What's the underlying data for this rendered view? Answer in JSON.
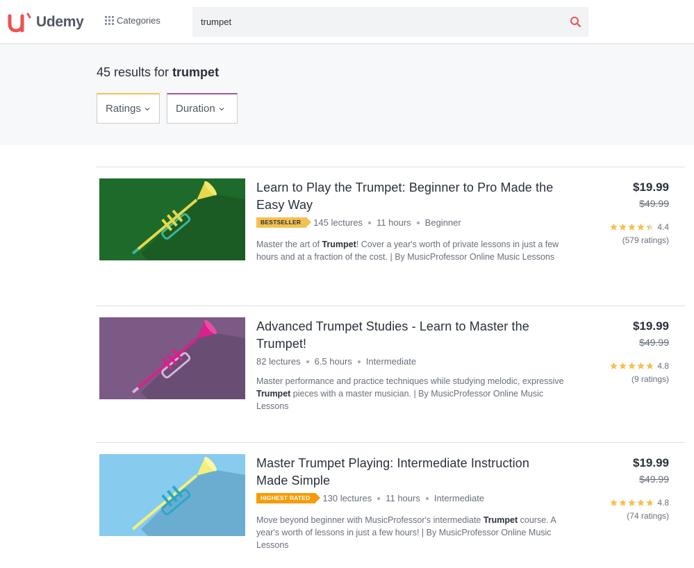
{
  "header": {
    "logo_text": "Udemy",
    "categories_label": "Categories",
    "search_value": "trumpet"
  },
  "results": {
    "count_prefix": "45 results for",
    "query": "trumpet"
  },
  "filters": {
    "ratings_label": "Ratings",
    "duration_label": "Duration"
  },
  "colors": {
    "brand": "#ec5252",
    "bestseller_badge": "#f4c150",
    "highest_rated_badge": "#f69c08",
    "star": "#f4c150"
  },
  "courses": [
    {
      "title": "Learn to Play the Trumpet: Beginner to Pro Made the Easy Way",
      "badge": "BESTSELLER",
      "lectures": "145 lectures",
      "duration": "11 hours",
      "level": "Beginner",
      "desc_pre": "Master the art of ",
      "desc_bold": "Trumpet",
      "desc_post": "! Cover a year's worth of private lessons in just a few hours and at a fraction of the cost. | By MusicProfessor Online Music Lessons",
      "price": "$19.99",
      "list_price": "$49.99",
      "rating": "4.4",
      "rating_value": 4.4,
      "ratings_count": "(579 ratings)",
      "thumb_bg": "#1e6a2a",
      "thumb_icon": "trumpet-icon"
    },
    {
      "title": "Advanced Trumpet Studies - Learn to Master the Trumpet!",
      "badge": "",
      "lectures": "82 lectures",
      "duration": "6.5 hours",
      "level": "Intermediate",
      "desc_pre": "Master performance and practice techniques while studying melodic, expressive ",
      "desc_bold": "Trumpet",
      "desc_post": " pieces with a master musician. | By MusicProfessor Online Music Lessons",
      "price": "$19.99",
      "list_price": "$49.99",
      "rating": "4.8",
      "rating_value": 4.8,
      "ratings_count": "(9 ratings)",
      "thumb_bg": "#7b5a85",
      "thumb_icon": "trumpet-icon"
    },
    {
      "title": "Master Trumpet Playing: Intermediate Instruction Made Simple",
      "badge": "HIGHEST RATED",
      "lectures": "130 lectures",
      "duration": "11 hours",
      "level": "Intermediate",
      "desc_pre": "Move beyond beginner with MusicProfessor's intermediate ",
      "desc_bold": "Trumpet",
      "desc_post": " course. A year's worth of lessons in just a few hours! | By MusicProfessor Online Music Lessons",
      "price": "$19.99",
      "list_price": "$49.99",
      "rating": "4.8",
      "rating_value": 4.8,
      "ratings_count": "(74 ratings)",
      "thumb_bg": "#87cbef",
      "thumb_icon": "trumpet-icon"
    }
  ]
}
